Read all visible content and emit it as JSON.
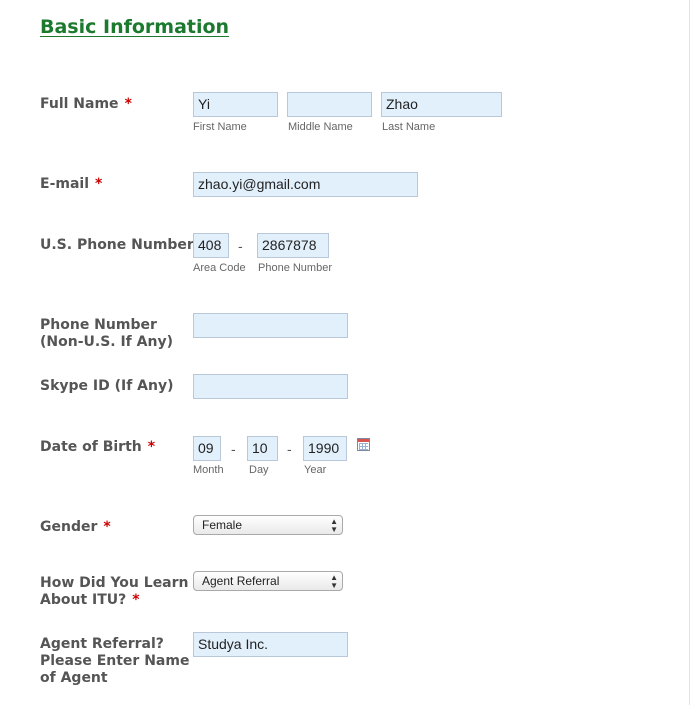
{
  "section_title": "Basic Information",
  "required_mark": "*",
  "full_name": {
    "label": "Full Name",
    "first": {
      "value": "Yi",
      "sublabel": "First Name"
    },
    "middle": {
      "value": "",
      "sublabel": "Middle Name"
    },
    "last": {
      "value": "Zhao",
      "sublabel": "Last Name"
    }
  },
  "email": {
    "label": "E-mail",
    "value": "zhao.yi@gmail.com"
  },
  "us_phone": {
    "label": "U.S. Phone Number",
    "area": {
      "value": "408",
      "sublabel": "Area Code"
    },
    "separator": "-",
    "number": {
      "value": "2867878",
      "sublabel": "Phone Number"
    }
  },
  "non_us_phone": {
    "label_line1": "Phone Number",
    "label_line2": "(Non-U.S. If Any)",
    "value": ""
  },
  "skype": {
    "label": "Skype ID (If Any)",
    "value": ""
  },
  "dob": {
    "label": "Date of Birth",
    "separator": "-",
    "month": {
      "value": "09",
      "sublabel": "Month"
    },
    "day": {
      "value": "10",
      "sublabel": "Day"
    },
    "year": {
      "value": "1990",
      "sublabel": "Year"
    },
    "calendar_icon": "calendar-icon"
  },
  "gender": {
    "label": "Gender",
    "selected": "Female"
  },
  "learn_about": {
    "label_line1": "How Did You Learn",
    "label_line2": "About ITU?",
    "selected": "Agent Referral"
  },
  "agent_referral": {
    "label_line1": "Agent Referral?",
    "label_line2": "Please Enter Name",
    "label_line3": "of Agent",
    "value": "Studya Inc."
  },
  "colors": {
    "heading": "#1c7a2e",
    "required": "#cc0000",
    "input_bg": "#e2f0fc"
  }
}
